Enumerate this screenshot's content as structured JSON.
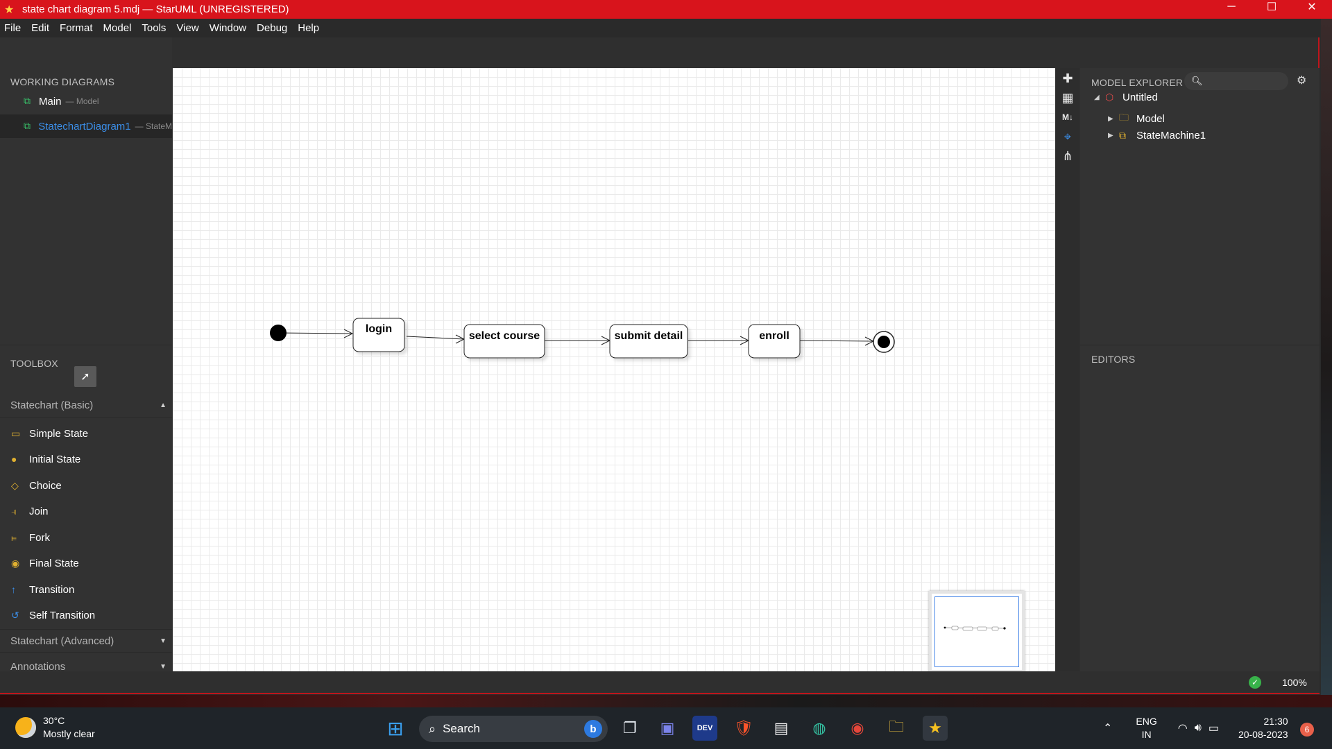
{
  "window": {
    "title": "state chart diagram 5.mdj — StarUML (UNREGISTERED)",
    "controls": {
      "minimize": "─",
      "maximize": "☐",
      "close": "✕"
    }
  },
  "menu": [
    "File",
    "Edit",
    "Format",
    "Model",
    "Tools",
    "View",
    "Window",
    "Debug",
    "Help"
  ],
  "working_diagrams": {
    "title": "WORKING DIAGRAMS",
    "items": [
      {
        "name": "Main",
        "sub": "— Model",
        "icon": "class-diagram-icon"
      },
      {
        "name": "StatechartDiagram1",
        "sub": "— StateM",
        "icon": "statechart-diagram-icon"
      }
    ]
  },
  "toolbox": {
    "title": "TOOLBOX",
    "groups": [
      {
        "label": "Statechart (Basic)",
        "arrow": "▲"
      },
      {
        "label": "Statechart (Advanced)",
        "arrow": "▼"
      },
      {
        "label": "Annotations",
        "arrow": "▼"
      }
    ],
    "tools": [
      {
        "label": "Simple State",
        "icon": "simple-state-icon"
      },
      {
        "label": "Initial State",
        "icon": "initial-state-icon"
      },
      {
        "label": "Choice",
        "icon": "choice-icon"
      },
      {
        "label": "Join",
        "icon": "join-icon"
      },
      {
        "label": "Fork",
        "icon": "fork-icon"
      },
      {
        "label": "Final State",
        "icon": "final-state-icon"
      },
      {
        "label": "Transition",
        "icon": "transition-icon"
      },
      {
        "label": "Self Transition",
        "icon": "self-transition-icon"
      }
    ]
  },
  "diagram": {
    "states": [
      "login",
      "select course",
      "submit detail",
      "enroll"
    ],
    "has_initial": true,
    "has_final": true
  },
  "model_explorer": {
    "title": "MODEL EXPLORER",
    "tree": [
      {
        "label": "Untitled",
        "expanded": true,
        "icon": "project-icon"
      },
      {
        "label": "Model",
        "expanded": false,
        "icon": "package-icon"
      },
      {
        "label": "StateMachine1",
        "expanded": false,
        "icon": "state-machine-icon"
      }
    ]
  },
  "editors": {
    "title": "EDITORS"
  },
  "status": {
    "zoom": "100%"
  },
  "taskbar": {
    "weather": {
      "temp": "30°C",
      "desc": "Mostly clear"
    },
    "search_placeholder": "Search",
    "lang": {
      "line1": "ENG",
      "line2": "IN"
    },
    "clock": {
      "time": "21:30",
      "date": "20-08-2023"
    },
    "notifications": "6"
  },
  "colors": {
    "titlebar": "#d8141c",
    "accent_blue": "#3b8ee8",
    "canvas": "#ffffff"
  }
}
